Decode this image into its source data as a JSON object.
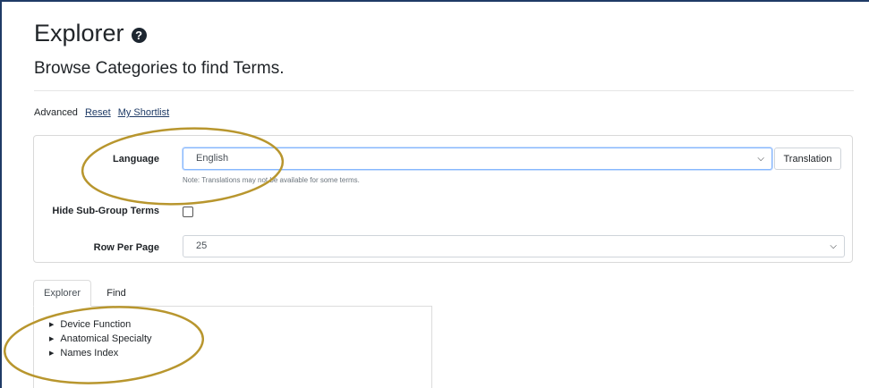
{
  "header": {
    "title": "Explorer",
    "help_icon": "question-circle-icon",
    "subtitle": "Browse Categories to find Terms."
  },
  "links": {
    "advanced": "Advanced",
    "reset": "Reset",
    "shortlist": "My Shortlist"
  },
  "form": {
    "language_label": "Language",
    "language_value": "English",
    "translation_button": "Translation",
    "note": "Note: Translations may not be available for some terms.",
    "hide_subgroup_label": "Hide Sub-Group Terms",
    "hide_subgroup_checked": false,
    "rows_label": "Row Per Page",
    "rows_value": "25"
  },
  "tabs": [
    {
      "label": "Explorer",
      "active": true
    },
    {
      "label": "Find",
      "active": false
    }
  ],
  "tree": {
    "items": [
      {
        "label": "Device Function"
      },
      {
        "label": "Anatomical Specialty"
      },
      {
        "label": "Names Index"
      }
    ]
  },
  "colors": {
    "frame": "#1f3b66",
    "annotation": "#b8962e",
    "link": "#1f3b66"
  }
}
